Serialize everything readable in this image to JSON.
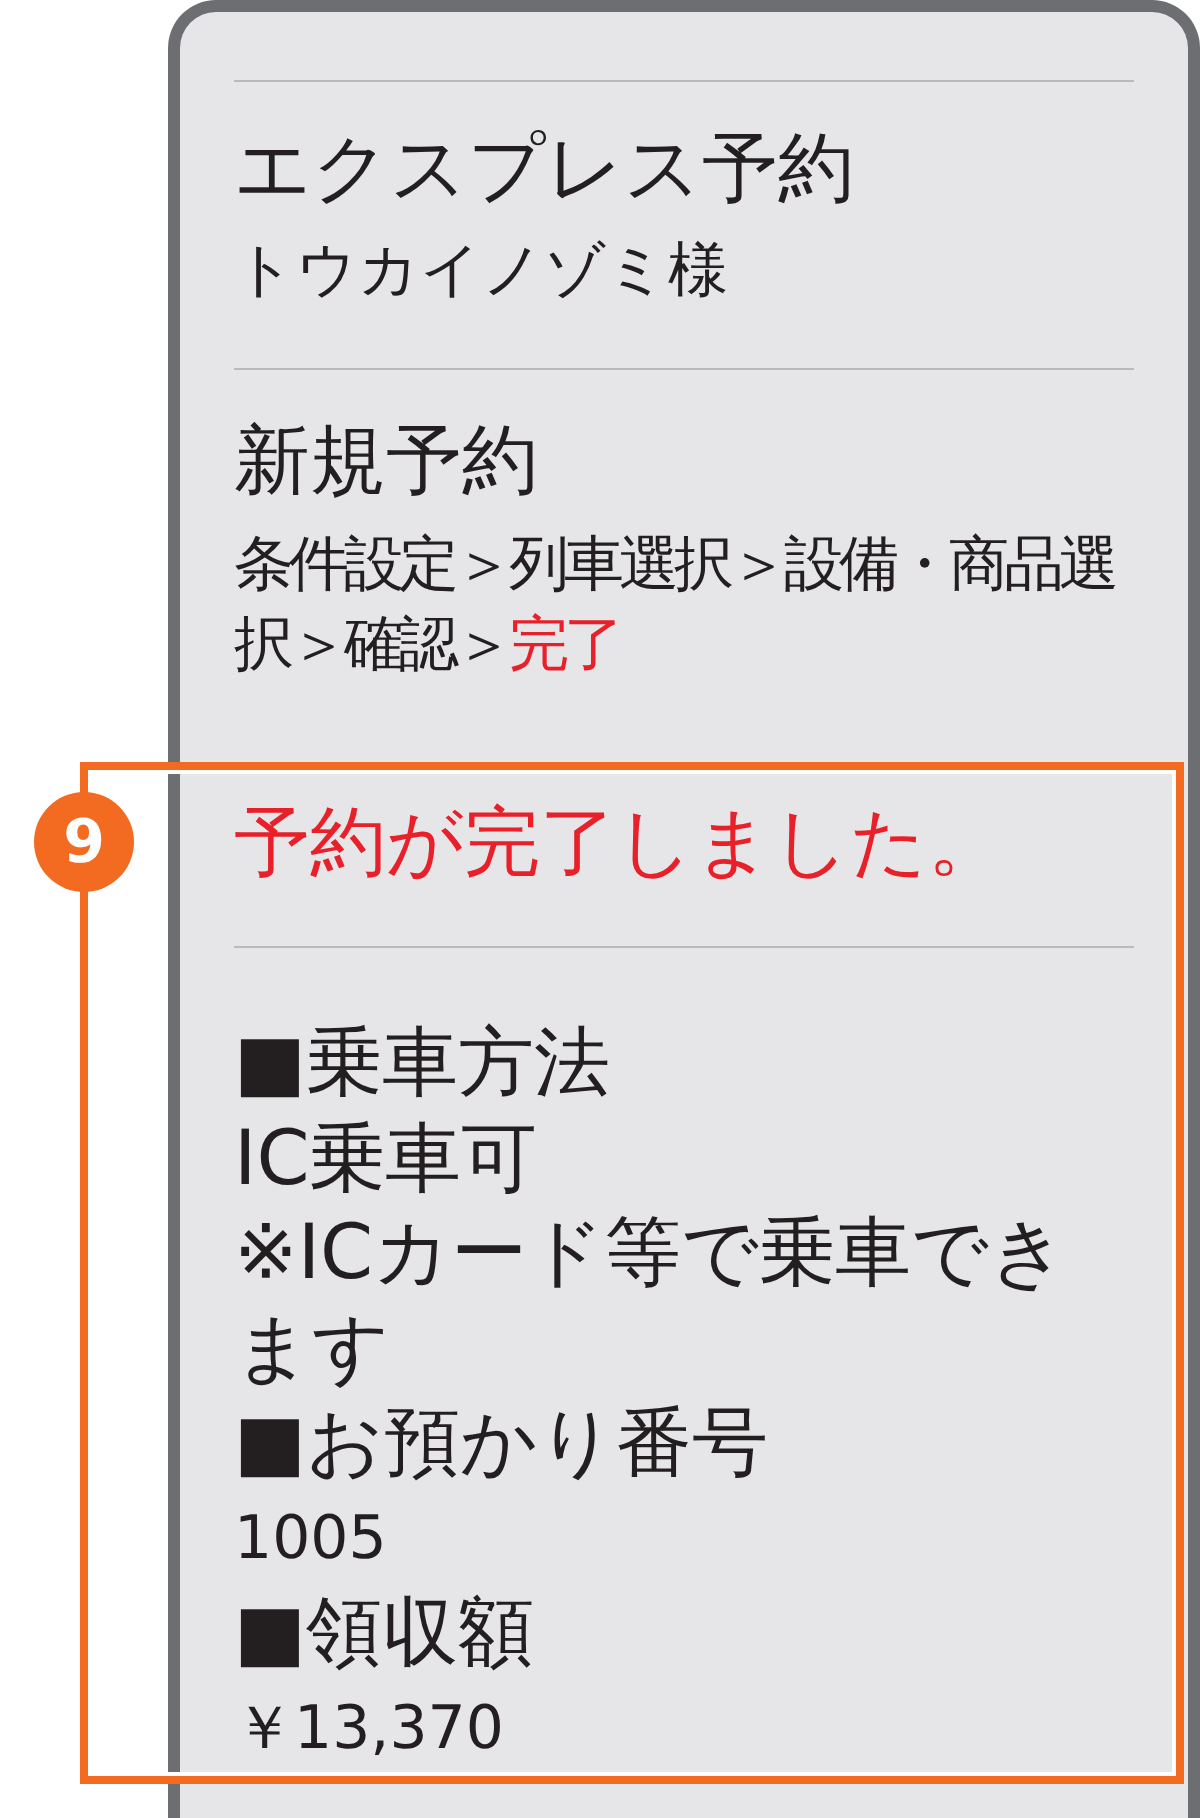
{
  "header": {
    "service": "エクスプレス予約",
    "customer": "トウカイノゾミ様"
  },
  "reservation": {
    "title": "新規予約",
    "steps": [
      {
        "label": "条件設定",
        "separator": "＞",
        "current": false
      },
      {
        "label": "列車選択",
        "separator": "＞",
        "current": false
      },
      {
        "label": "設備・商品選択",
        "separator": "＞",
        "current": false
      },
      {
        "label": "確認",
        "separator": "＞",
        "current": false
      },
      {
        "label": "完了",
        "current": true
      }
    ]
  },
  "highlight": {
    "callout": "9",
    "message": "予約が完了しました。",
    "details": [
      {
        "label": "■乗車方法",
        "kind": "text",
        "values": [
          "IC乗車可",
          "※ICカード等で乗車できます"
        ]
      },
      {
        "label": "■お預かり番号",
        "kind": "number",
        "values": [
          "1005"
        ]
      },
      {
        "label": "■領収額",
        "kind": "number",
        "values": [
          "￥13,370"
        ]
      }
    ]
  }
}
